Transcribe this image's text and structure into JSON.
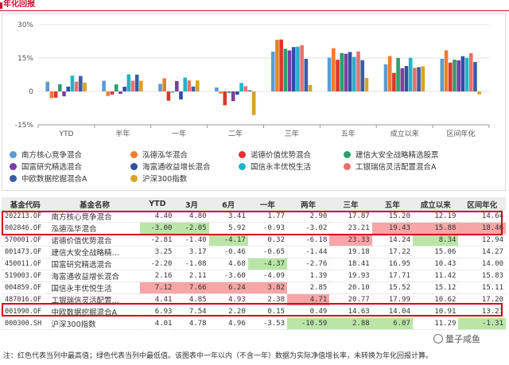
{
  "header": {
    "title": "年化回报"
  },
  "chart_data": {
    "type": "bar",
    "categories": [
      "YTD",
      "半年",
      "一年",
      "二年",
      "三年",
      "五年",
      "成立以来",
      "区间年化"
    ],
    "y_ticks": [
      "30%",
      "15%",
      "0",
      "-15%"
    ],
    "ylim": [
      -15,
      30
    ],
    "colors": {
      "南方核心竞争混合": "#5b9bd5",
      "泓德泓华混合": "#ed7d31",
      "诺德价值优势混合": "#e0342c",
      "建信大安全战略精选股票": "#2e9e6a",
      "国富研究精选混合": "#7a3fa0",
      "海富通收益增长混合": "#2f4fa3",
      "国信永丰优悦生活": "#1fb5c8",
      "工银瑞信灵活配置混合A": "#e8706f",
      "中欧数据挖掘混合A": "#3a5da8",
      "沪深300指数": "#d9a12c"
    },
    "series": [
      {
        "name": "南方核心竞争混合",
        "values": [
          4.4,
          4.8,
          3.41,
          1.77,
          17.87,
          15.2,
          12.19,
          14.64
        ]
      },
      {
        "name": "泓德泓华混合",
        "values": [
          -3.0,
          -2.05,
          5.92,
          -0.93,
          23.21,
          19.43,
          15.88,
          18.46
        ]
      },
      {
        "name": "诺德价值优势混合",
        "values": [
          -2.81,
          -1.4,
          -4.17,
          -6.18,
          23.33,
          14.24,
          8.34,
          12.94
        ]
      },
      {
        "name": "建信大安全战略精选股票",
        "values": [
          3.25,
          3.17,
          -0.46,
          -0.65,
          19.18,
          17.22,
          15.06,
          14.27
        ]
      },
      {
        "name": "国富研究精选混合",
        "values": [
          -2.2,
          -1.08,
          4.68,
          -4.37,
          18.41,
          16.95,
          10.43,
          14.0
        ]
      },
      {
        "name": "海富通收益增长混合",
        "values": [
          2.16,
          2.11,
          -3.6,
          -1.44,
          19.93,
          17.71,
          11.42,
          15.83
        ]
      },
      {
        "name": "国信永丰优悦生活",
        "values": [
          7.12,
          7.66,
          6.24,
          3.82,
          20.1,
          15.52,
          15.12,
          15.11
        ]
      },
      {
        "name": "工银瑞信灵活配置混合A",
        "values": [
          4.41,
          4.85,
          4.93,
          2.38,
          20.77,
          17.99,
          10.62,
          17.2
        ]
      },
      {
        "name": "中欧数据挖掘混合A",
        "values": [
          6.93,
          7.54,
          2.2,
          0.49,
          14.63,
          14.04,
          10.91,
          13.21
        ]
      },
      {
        "name": "沪深300指数",
        "values": [
          4.01,
          4.78,
          4.96,
          -10.59,
          2.88,
          6.07,
          11.29,
          -1.31
        ]
      }
    ]
  },
  "table": {
    "headers": [
      "基金代码",
      "基金名称",
      "YTD",
      "3月",
      "6月",
      "一年",
      "两年",
      "三年",
      "五年",
      "成立以来",
      "区间年化"
    ],
    "rows": [
      {
        "code": "202213.OF",
        "name": "南方核心竞争混合",
        "vals": [
          "4.40",
          "4.80",
          "3.41",
          "1.77",
          "2.90",
          "17.87",
          "15.20",
          "12.19",
          "14.64"
        ],
        "hl": [
          "",
          "",
          "",
          "",
          "",
          "",
          "",
          "",
          ""
        ]
      },
      {
        "code": "002846.OF",
        "name": "泓德泓华混合",
        "vals": [
          "-3.00",
          "-2.05",
          "5.92",
          "-0.93",
          "-3.02",
          "23.21",
          "19.43",
          "15.88",
          "18.46"
        ],
        "hl": [
          "green",
          "green",
          "",
          "",
          "",
          "",
          "red",
          "red",
          "red"
        ]
      },
      {
        "code": "570001.OF",
        "name": "诺德价值优势混合",
        "vals": [
          "-2.81",
          "-1.40",
          "-4.17",
          "0.32",
          "-6.18",
          "23.33",
          "14.24",
          "8.34",
          "12.94"
        ],
        "hl": [
          "",
          "",
          "green",
          "",
          "",
          "red",
          "",
          "green",
          ""
        ]
      },
      {
        "code": "001473.OF",
        "name": "建信大安全战略精…",
        "vals": [
          "3.25",
          "3.17",
          "-0.46",
          "-0.65",
          "-1.44",
          "19.18",
          "17.22",
          "15.06",
          "14.27"
        ],
        "hl": [
          "",
          "",
          "",
          "",
          "",
          "",
          "",
          "",
          ""
        ]
      },
      {
        "code": "450011.OF",
        "name": "国富研究精选混合",
        "vals": [
          "-2.20",
          "-1.08",
          "4.68",
          "-4.37",
          "-2.76",
          "18.41",
          "16.95",
          "10.43",
          "14.00"
        ],
        "hl": [
          "",
          "",
          "",
          "green",
          "",
          "",
          "",
          "",
          ""
        ]
      },
      {
        "code": "519003.OF",
        "name": "海富通收益增长混合",
        "vals": [
          "2.16",
          "2.11",
          "-3.60",
          "-4.09",
          "1.39",
          "19.93",
          "17.71",
          "11.42",
          "15.83"
        ],
        "hl": [
          "",
          "",
          "",
          "",
          "",
          "",
          "",
          "",
          ""
        ]
      },
      {
        "code": "004859.OF",
        "name": "国信永丰优悦生活",
        "vals": [
          "7.12",
          "7.66",
          "6.24",
          "3.82",
          "2.85",
          "20.10",
          "15.52",
          "15.12",
          "15.11"
        ],
        "hl": [
          "red",
          "red",
          "red",
          "red",
          "",
          "",
          "",
          "",
          ""
        ]
      },
      {
        "code": "487016.OF",
        "name": "工银瑞信灵活配置…",
        "vals": [
          "4.41",
          "4.85",
          "4.93",
          "2.38",
          "4.71",
          "20.77",
          "17.99",
          "10.62",
          "17.20"
        ],
        "hl": [
          "",
          "",
          "",
          "",
          "red",
          "",
          "",
          "",
          ""
        ]
      },
      {
        "code": "001990.OF",
        "name": "中欧数据挖掘混合A",
        "vals": [
          "6.93",
          "7.54",
          "2.20",
          "0.15",
          "0.49",
          "14.63",
          "14.04",
          "10.91",
          "13.21"
        ],
        "hl": [
          "",
          "",
          "",
          "",
          "",
          "",
          "",
          "",
          ""
        ]
      },
      {
        "code": "000300.SH",
        "name": "沪深300指数",
        "vals": [
          "4.01",
          "4.78",
          "4.96",
          "-3.53",
          "-10.59",
          "2.88",
          "6.07",
          "11.29",
          "-1.31"
        ],
        "hl": [
          "",
          "",
          "",
          "",
          "green",
          "green",
          "green",
          "",
          "green"
        ]
      }
    ]
  },
  "note": "注：红色代表当列中最高值；绿色代表当列中最低值。该图表中一年以内（不含一年）数据为实际净值增长率，未转换为年化回报计算。",
  "watermark": "量子咸鱼"
}
